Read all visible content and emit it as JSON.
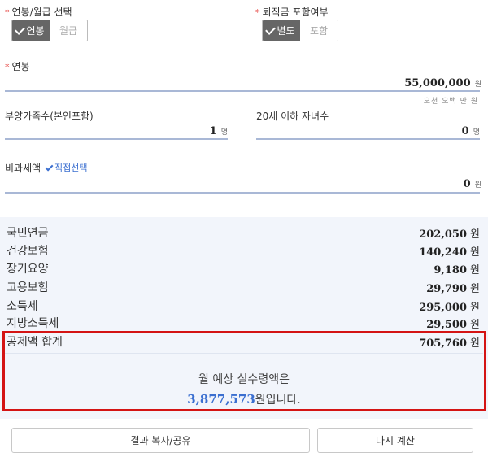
{
  "salary_type": {
    "label": "연봉/월급 선택",
    "options": [
      "연봉",
      "월급"
    ],
    "selected": 0
  },
  "severance": {
    "label": "퇴직금 포함여부",
    "options": [
      "별도",
      "포함"
    ],
    "selected": 0
  },
  "annual_salary": {
    "label": "연봉",
    "value": "55,000,000",
    "unit": "원",
    "hint": "오천 오백 만 원"
  },
  "dependents": {
    "label": "부양가족수(본인포함)",
    "value": "1",
    "unit": "명"
  },
  "children": {
    "label": "20세 이하 자녀수",
    "value": "0",
    "unit": "명"
  },
  "nontax": {
    "label": "비과세액",
    "link": "직접선택",
    "value": "0",
    "unit": "원"
  },
  "deductions": [
    {
      "label": "국민연금",
      "value": "202,050",
      "unit": "원"
    },
    {
      "label": "건강보험",
      "value": "140,240",
      "unit": "원"
    },
    {
      "label": "장기요양",
      "value": "9,180",
      "unit": "원"
    },
    {
      "label": "고용보험",
      "value": "29,790",
      "unit": "원"
    },
    {
      "label": "소득세",
      "value": "295,000",
      "unit": "원"
    },
    {
      "label": "지방소득세",
      "value": "29,500",
      "unit": "원"
    }
  ],
  "total": {
    "label": "공제액 합계",
    "value": "705,760",
    "unit": "원"
  },
  "result": {
    "title": "월 예상 실수령액은",
    "amount": "3,877,573",
    "suffix": "원입니다."
  },
  "buttons": {
    "share": "결과 복사/공유",
    "recalc": "다시 계산"
  },
  "colors": {
    "accent_blue": "#3b6fd0",
    "highlight_red": "#d41414",
    "selected_toggle": "#666666",
    "panel_bg": "#f2f5fb"
  }
}
